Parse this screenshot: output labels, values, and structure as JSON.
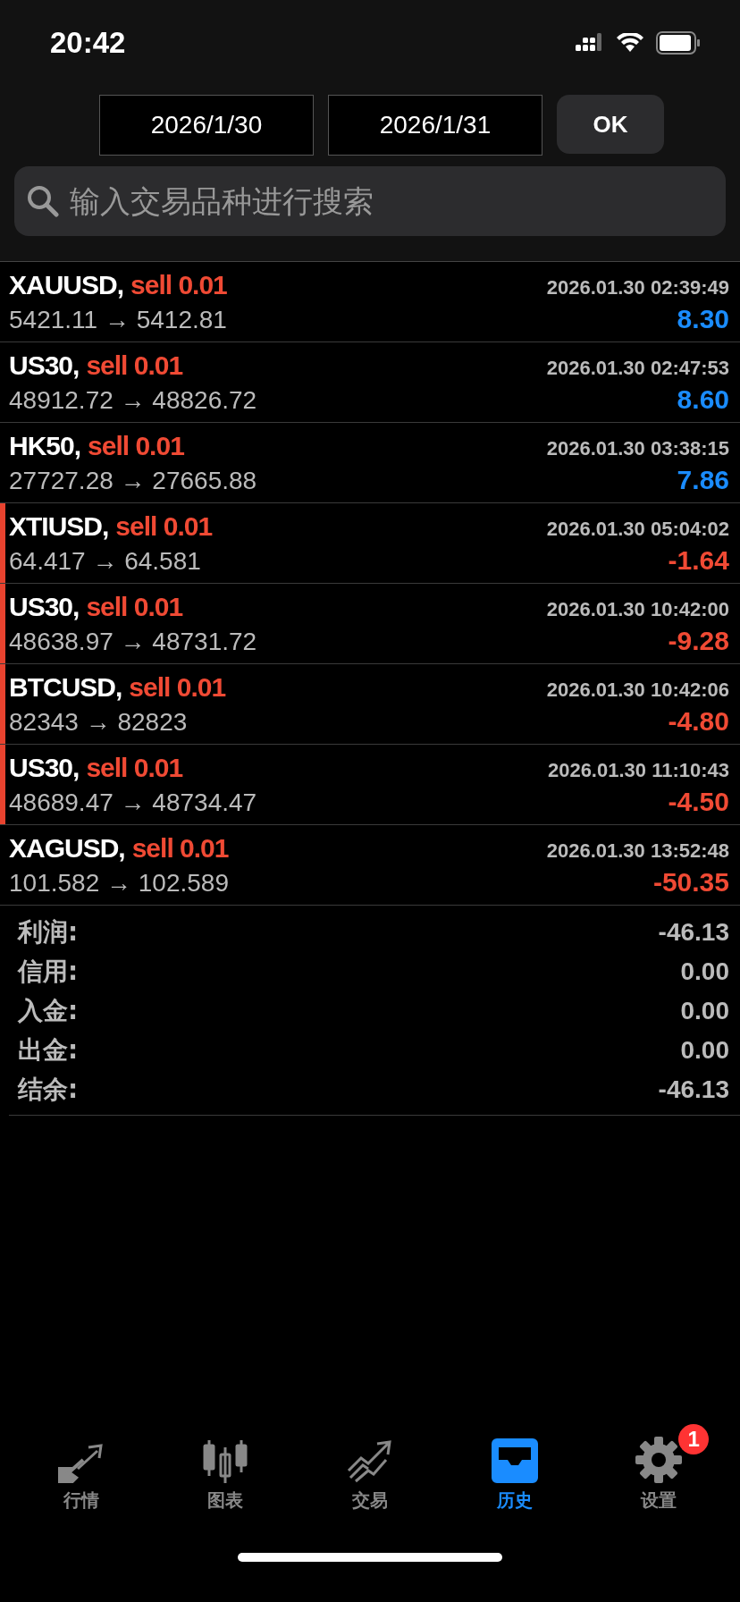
{
  "status_bar": {
    "time": "20:42"
  },
  "date_range": {
    "from": "2026/1/30",
    "to": "2026/1/31",
    "ok": "OK"
  },
  "search": {
    "placeholder": "输入交易品种进行搜索"
  },
  "trades": [
    {
      "symbol": "XAUUSD,",
      "side": "sell 0.01",
      "time": "2026.01.30 02:39:49",
      "prices": "5421.11 → 5412.81",
      "profit": "8.30",
      "kind": "gain",
      "marked": false
    },
    {
      "symbol": "US30,",
      "side": "sell 0.01",
      "time": "2026.01.30 02:47:53",
      "prices": "48912.72 → 48826.72",
      "profit": "8.60",
      "kind": "gain",
      "marked": false
    },
    {
      "symbol": "HK50,",
      "side": "sell 0.01",
      "time": "2026.01.30 03:38:15",
      "prices": "27727.28 → 27665.88",
      "profit": "7.86",
      "kind": "gain",
      "marked": false
    },
    {
      "symbol": "XTIUSD,",
      "side": "sell 0.01",
      "time": "2026.01.30 05:04:02",
      "prices": "64.417 → 64.581",
      "profit": "-1.64",
      "kind": "loss",
      "marked": true
    },
    {
      "symbol": "US30,",
      "side": "sell 0.01",
      "time": "2026.01.30 10:42:00",
      "prices": "48638.97 → 48731.72",
      "profit": "-9.28",
      "kind": "loss",
      "marked": true
    },
    {
      "symbol": "BTCUSD,",
      "side": "sell 0.01",
      "time": "2026.01.30 10:42:06",
      "prices": "82343 → 82823",
      "profit": "-4.80",
      "kind": "loss",
      "marked": true
    },
    {
      "symbol": "US30,",
      "side": "sell 0.01",
      "time": "2026.01.30 11:10:43",
      "prices": "48689.47 → 48734.47",
      "profit": "-4.50",
      "kind": "loss",
      "marked": true
    },
    {
      "symbol": "XAGUSD,",
      "side": "sell 0.01",
      "time": "2026.01.30 13:52:48",
      "prices": "101.582 → 102.589",
      "profit": "-50.35",
      "kind": "loss",
      "marked": false
    }
  ],
  "summary": [
    {
      "label": "利润:",
      "value": "-46.13"
    },
    {
      "label": "信用:",
      "value": "0.00"
    },
    {
      "label": "入金:",
      "value": "0.00"
    },
    {
      "label": "出金:",
      "value": "0.00"
    },
    {
      "label": "结余:",
      "value": "-46.13"
    }
  ],
  "tabs": [
    {
      "label": "行情",
      "selected": false
    },
    {
      "label": "图表",
      "selected": false
    },
    {
      "label": "交易",
      "selected": false
    },
    {
      "label": "历史",
      "selected": true
    },
    {
      "label": "设置",
      "selected": false,
      "badge": "1"
    }
  ]
}
